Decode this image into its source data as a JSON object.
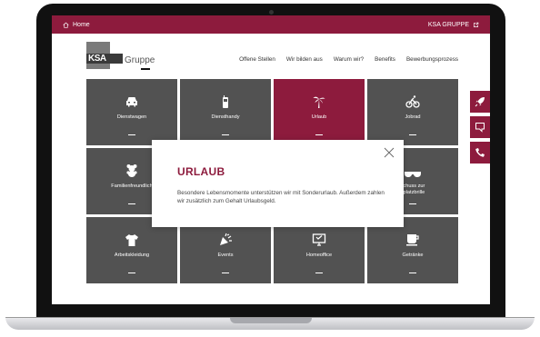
{
  "topbar": {
    "home_label": "Home",
    "brand_label": "KSA GRUPPE"
  },
  "header": {
    "logo_text": "KSA",
    "logo_sub": "Gruppe",
    "nav": [
      "Offene Stellen",
      "Wir bilden aus",
      "Warum wir?",
      "Benefits",
      "Bewerbungsprozess"
    ]
  },
  "tiles": [
    {
      "label": "Dienstwagen",
      "icon": "car-icon"
    },
    {
      "label": "Diensthandy",
      "icon": "phone-icon"
    },
    {
      "label": "Urlaub",
      "icon": "palm-tree-icon",
      "active": true
    },
    {
      "label": "Jobrad",
      "icon": "bicycle-icon"
    },
    {
      "label": "Familienfreundlich",
      "icon": "teddy-bear-icon"
    },
    {
      "label": "",
      "icon": ""
    },
    {
      "label": "",
      "icon": ""
    },
    {
      "label": "schuss zur\nsplatzbrille",
      "icon": "glasses-icon"
    },
    {
      "label": "Arbeitskleidung",
      "icon": "tshirt-icon"
    },
    {
      "label": "Events",
      "icon": "party-popper-icon"
    },
    {
      "label": "Homeoffice",
      "icon": "monitor-icon"
    },
    {
      "label": "Getränke",
      "icon": "coffee-icon"
    }
  ],
  "modal": {
    "title": "URLAUB",
    "text": "Besondere Lebensmomente unterstützen wir mit Sonderurlaub. Außerdem zahlen wir zusätzlich zum Gehalt Urlaubsgeld."
  },
  "side_buttons": [
    "rocket-icon",
    "chat-icon",
    "phone-call-icon"
  ],
  "colors": {
    "brand": "#8d1b3d",
    "tile": "#525252"
  }
}
